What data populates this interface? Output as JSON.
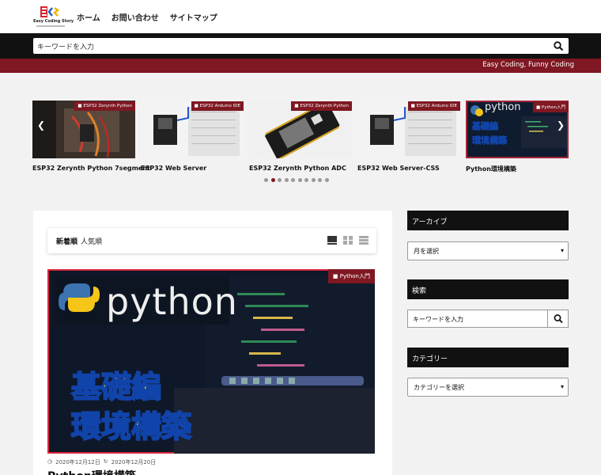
{
  "header": {
    "logo_text": "Easy Coding Story",
    "nav": [
      "ホーム",
      "お問い合わせ",
      "サイトマップ"
    ]
  },
  "search": {
    "placeholder": "キーワードを入力"
  },
  "tagline": "Easy Coding, Funny Coding",
  "carousel": {
    "slides": [
      {
        "category": "ESP32 Zerynth Python",
        "title": "ESP32 Zerynth Python 7segment"
      },
      {
        "category": "ESP32 Arduino IDE",
        "title": "ESP32 Web Server"
      },
      {
        "category": "ESP32 Zerynth Python",
        "title": "ESP32 Zerynth Python ADC"
      },
      {
        "category": "ESP32 Arduino IDE",
        "title": "ESP32 Web Server-CSS"
      },
      {
        "category": "Python入門",
        "title": "Python環境構築",
        "thumb_text": "python",
        "thumb_line1": "基礎編",
        "thumb_line2": "環境構築"
      }
    ],
    "dot_count": 10,
    "active_dot": 1
  },
  "main": {
    "tabs": [
      "新着順",
      "人気順"
    ],
    "featured": {
      "category": "Python入門",
      "logo_text": "python",
      "overlay_line1": "基礎編",
      "overlay_line2": "環境構築",
      "published": "2020年12月12日",
      "updated": "2020年12月20日",
      "title": "Python環境構築"
    }
  },
  "sidebar": {
    "archive_heading": "アーカイブ",
    "archive_select": "月を選択",
    "search_heading": "検索",
    "search_placeholder": "キーワードを入力",
    "category_heading": "カテゴリー",
    "category_select": "カテゴリーを選択"
  },
  "colors": {
    "accent": "#7f1822",
    "dark": "#111111",
    "background": "#f2f2f2"
  }
}
